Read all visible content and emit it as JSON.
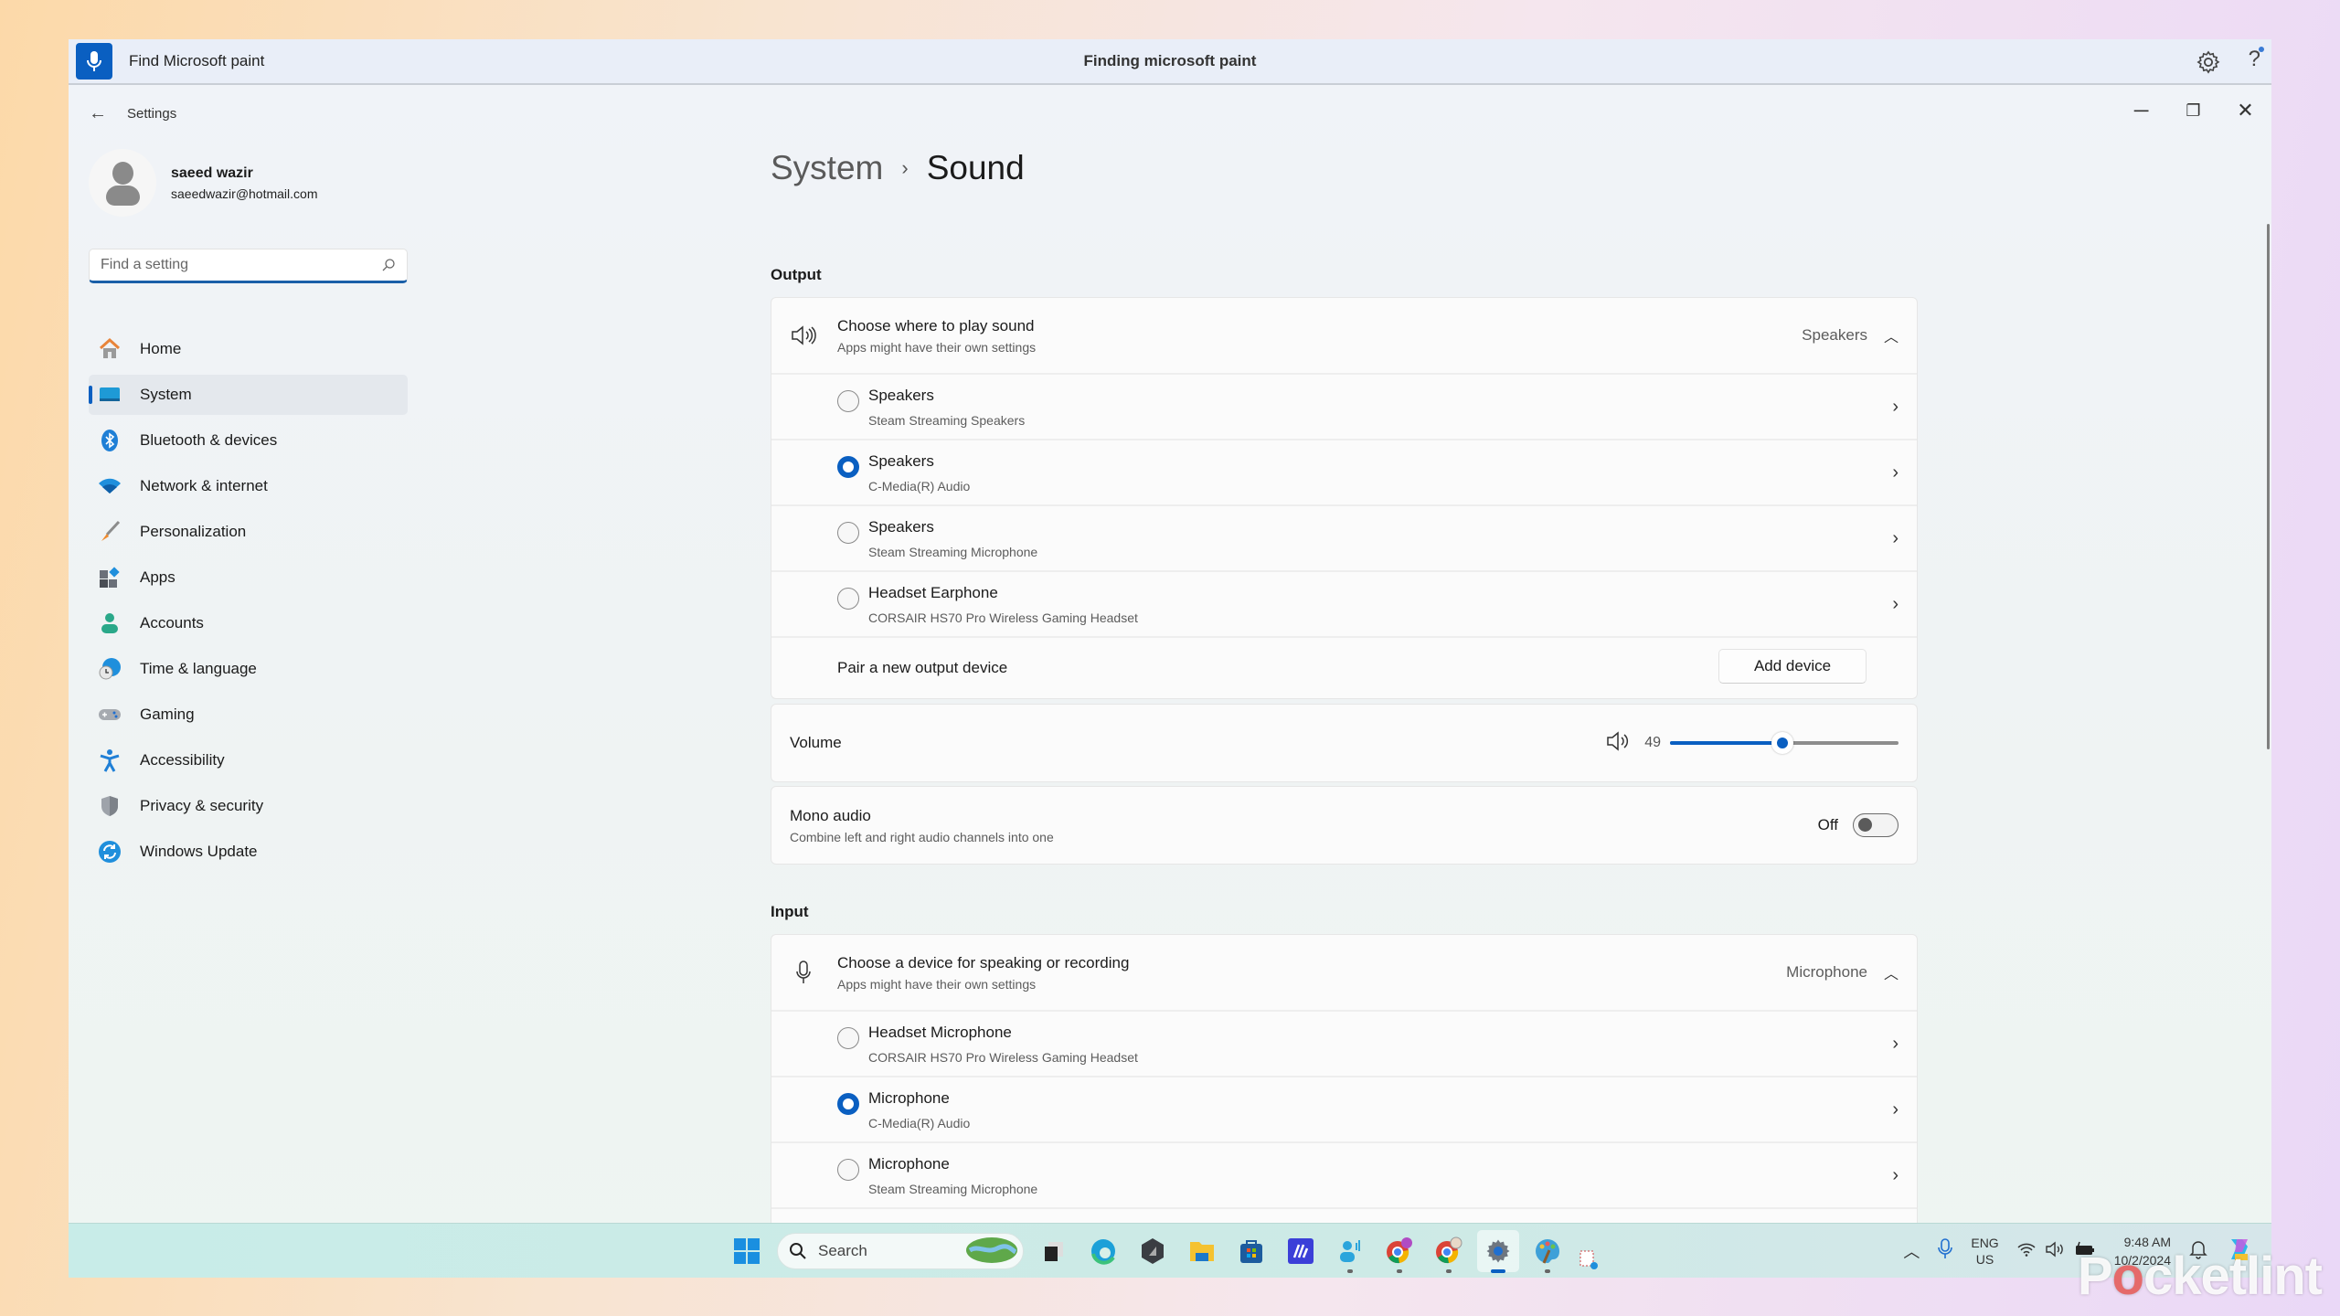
{
  "voice_access": {
    "command": "Find Microsoft paint",
    "status": "Finding microsoft paint"
  },
  "window": {
    "title": "Settings",
    "controls": {
      "minimize": "─",
      "maximize": "❐",
      "close": "✕"
    }
  },
  "profile": {
    "name": "saeed wazir",
    "email": "saeedwazir@hotmail.com"
  },
  "search": {
    "placeholder": "Find a setting",
    "value": ""
  },
  "sidebar": {
    "items": [
      {
        "label": "Home",
        "icon": "home-icon",
        "active": false
      },
      {
        "label": "System",
        "icon": "system-icon",
        "active": true
      },
      {
        "label": "Bluetooth & devices",
        "icon": "bluetooth-icon",
        "active": false
      },
      {
        "label": "Network & internet",
        "icon": "wifi-icon",
        "active": false
      },
      {
        "label": "Personalization",
        "icon": "brush-icon",
        "active": false
      },
      {
        "label": "Apps",
        "icon": "apps-icon",
        "active": false
      },
      {
        "label": "Accounts",
        "icon": "accounts-icon",
        "active": false
      },
      {
        "label": "Time & language",
        "icon": "globe-clock-icon",
        "active": false
      },
      {
        "label": "Gaming",
        "icon": "gamepad-icon",
        "active": false
      },
      {
        "label": "Accessibility",
        "icon": "accessibility-icon",
        "active": false
      },
      {
        "label": "Privacy & security",
        "icon": "shield-icon",
        "active": false
      },
      {
        "label": "Windows Update",
        "icon": "update-icon",
        "active": false
      }
    ]
  },
  "breadcrumb": {
    "parent": "System",
    "separator": "›",
    "current": "Sound"
  },
  "output": {
    "section_label": "Output",
    "header": {
      "title": "Choose where to play sound",
      "subtitle": "Apps might have their own settings",
      "selected": "Speakers"
    },
    "devices": [
      {
        "name": "Speakers",
        "detail": "Steam Streaming Speakers",
        "selected": false
      },
      {
        "name": "Speakers",
        "detail": "C-Media(R) Audio",
        "selected": true
      },
      {
        "name": "Speakers",
        "detail": "Steam Streaming Microphone",
        "selected": false
      },
      {
        "name": "Headset Earphone",
        "detail": "CORSAIR HS70 Pro Wireless Gaming Headset",
        "selected": false
      }
    ],
    "pair_label": "Pair a new output device",
    "add_device_label": "Add device"
  },
  "volume": {
    "label": "Volume",
    "value": 49,
    "max": 100
  },
  "mono_audio": {
    "title": "Mono audio",
    "subtitle": "Combine left and right audio channels into one",
    "state_label": "Off",
    "on": false
  },
  "input": {
    "section_label": "Input",
    "header": {
      "title": "Choose a device for speaking or recording",
      "subtitle": "Apps might have their own settings",
      "selected": "Microphone"
    },
    "devices": [
      {
        "name": "Headset Microphone",
        "detail": "CORSAIR HS70 Pro Wireless Gaming Headset",
        "selected": false
      },
      {
        "name": "Microphone",
        "detail": "C-Media(R) Audio",
        "selected": true
      },
      {
        "name": "Microphone",
        "detail": "Steam Streaming Microphone",
        "selected": false
      }
    ]
  },
  "taskbar": {
    "search_label": "Search",
    "apps": [
      "start",
      "task-view",
      "edge",
      "app-dark",
      "file-explorer",
      "store",
      "app-m",
      "voice-access",
      "chrome-profile-s",
      "chrome-profile-2",
      "settings",
      "paint"
    ],
    "tray": {
      "lang_line1": "ENG",
      "lang_line2": "US",
      "time": "9:48 AM",
      "date": "10/2/2024"
    }
  },
  "watermark": {
    "pre": "P",
    "o": "o",
    "post": "cketlint"
  },
  "colors": {
    "accent": "#0a5fc1",
    "taskbar": "#c8ece8"
  }
}
